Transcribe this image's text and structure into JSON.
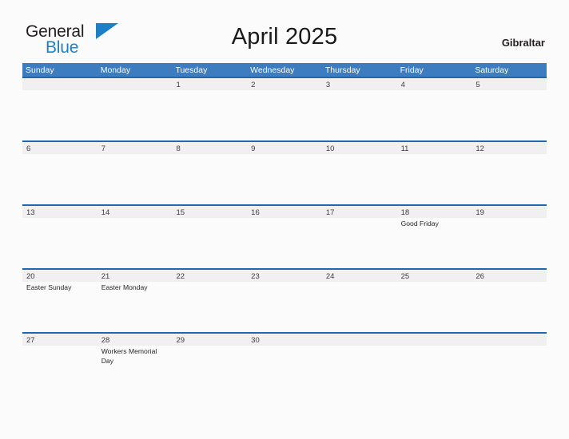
{
  "brand": {
    "name_top": "General",
    "name_bottom": "Blue",
    "flag_icon": "blue-triangle-flag-icon",
    "accent_color": "#1F7FC4"
  },
  "header": {
    "title": "April 2025",
    "location": "Gibraltar"
  },
  "theme": {
    "header_blue": "#3C7CBF",
    "rule_blue": "#1F68B0",
    "number_band_gray": "#F0F0F0",
    "page_background": "#FBFBFB",
    "text_dark": "#262626"
  },
  "calendar": {
    "weekdays": [
      "Sunday",
      "Monday",
      "Tuesday",
      "Wednesday",
      "Thursday",
      "Friday",
      "Saturday"
    ],
    "weeks": [
      [
        {
          "day": "",
          "events": []
        },
        {
          "day": "",
          "events": []
        },
        {
          "day": "1",
          "events": []
        },
        {
          "day": "2",
          "events": []
        },
        {
          "day": "3",
          "events": []
        },
        {
          "day": "4",
          "events": []
        },
        {
          "day": "5",
          "events": []
        }
      ],
      [
        {
          "day": "6",
          "events": []
        },
        {
          "day": "7",
          "events": []
        },
        {
          "day": "8",
          "events": []
        },
        {
          "day": "9",
          "events": []
        },
        {
          "day": "10",
          "events": []
        },
        {
          "day": "11",
          "events": []
        },
        {
          "day": "12",
          "events": []
        }
      ],
      [
        {
          "day": "13",
          "events": []
        },
        {
          "day": "14",
          "events": []
        },
        {
          "day": "15",
          "events": []
        },
        {
          "day": "16",
          "events": []
        },
        {
          "day": "17",
          "events": []
        },
        {
          "day": "18",
          "events": [
            "Good Friday"
          ]
        },
        {
          "day": "19",
          "events": []
        }
      ],
      [
        {
          "day": "20",
          "events": [
            "Easter Sunday"
          ]
        },
        {
          "day": "21",
          "events": [
            "Easter Monday"
          ]
        },
        {
          "day": "22",
          "events": []
        },
        {
          "day": "23",
          "events": []
        },
        {
          "day": "24",
          "events": []
        },
        {
          "day": "25",
          "events": []
        },
        {
          "day": "26",
          "events": []
        }
      ],
      [
        {
          "day": "27",
          "events": []
        },
        {
          "day": "28",
          "events": [
            "Workers Memorial Day"
          ]
        },
        {
          "day": "29",
          "events": []
        },
        {
          "day": "30",
          "events": []
        },
        {
          "day": "",
          "events": []
        },
        {
          "day": "",
          "events": []
        },
        {
          "day": "",
          "events": []
        }
      ]
    ]
  }
}
